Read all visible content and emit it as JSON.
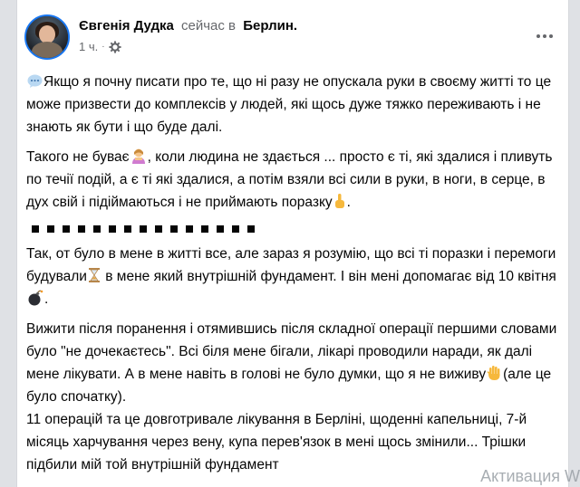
{
  "post": {
    "author": "Євгенія Дудка",
    "status": "сейчас в",
    "place": "Берлин.",
    "time": "1 ч.",
    "dot": "·"
  },
  "content": {
    "p1": "Якщо я почну писати про те, що ні разу не опускала руки в своєму житті то це може призвести до комплексів у людей, які щось дуже тяжко переживають і не знають як бути і що буде далі.",
    "p2a": "Такого не буває",
    "p2b": ", коли людина не здається ... просто є ті, які здалися і пливуть по течії подій, а є ті які здалися, а потім взяли всі сили в руки, в ноги, в серце, в дух свій і підіймаються і не приймають поразку",
    "p2c": ".",
    "p3a": "Так, от було в мене в житті все, але зараз я розумію, що всі ті поразки і перемоги будували",
    "p3b": " в мене який внутрішній фундамент. І він мені допомагає від 10 квітня",
    "p3c": ".",
    "p4a": "Вижити після поранення і отямившись після складної операції першими словами було \"не дочекаєтесь\". Всі біля мене бігали, лікарі проводили наради, як далі мене лікувати. А в мене навіть в голові не було думки, що я не виживу",
    "p4b": "(але це було спочатку).",
    "p5": "11 операцій та це довготривале лікування в Берліні, щоденні капельниці, 7-й місяць харчування через вену, купа перев'язок в мені щось змінили... Трішки підбили мій той внутрішній фундамент"
  },
  "icons": {
    "speech": "speech-bubble-icon",
    "person": "person-gesturing-icon",
    "pointing": "pointing-up-icon",
    "hourglass": "hourglass-icon",
    "bomb": "bomb-icon",
    "hand": "raised-hand-icon",
    "gear": "gear-icon",
    "more": "more-icon"
  },
  "separator_count": 15,
  "watermark": "Активация W",
  "colors": {
    "link": "#1877f2",
    "muted": "#65676b",
    "text": "#050505"
  }
}
